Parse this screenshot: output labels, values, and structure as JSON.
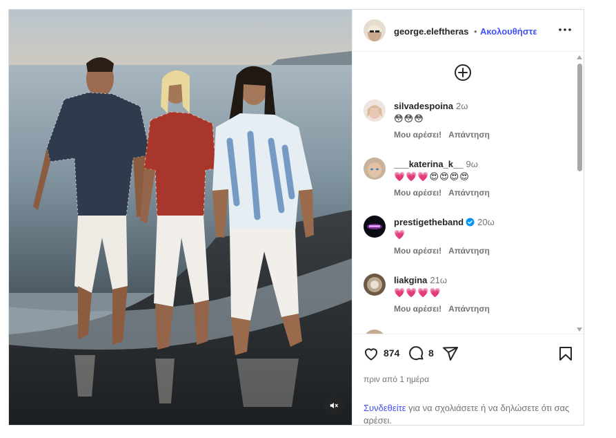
{
  "header": {
    "username": "george.eleftheras",
    "dot": "•",
    "follow_label": "Ακολουθήστε"
  },
  "comments": [
    {
      "username": "silvadespoina",
      "time": "2ω",
      "text": "😳😳😳",
      "like_label": "Μου αρέσει!",
      "reply_label": "Απάντηση"
    },
    {
      "username": "___katerina_k__",
      "time": "9ω",
      "text": "💗💗💗😍😍😍😍",
      "like_label": "Μου αρέσει!",
      "reply_label": "Απάντηση"
    },
    {
      "username": "prestigetheband",
      "time": "20ω",
      "text": "💗",
      "like_label": "Μου αρέσει!",
      "reply_label": "Απάντηση",
      "verified": true
    },
    {
      "username": "liakgina",
      "time": "21ω",
      "text": "💗💗💗💗",
      "like_label": "Μου αρέσει!",
      "reply_label": "Απάντηση"
    }
  ],
  "stats": {
    "likes": "874",
    "comments": "8",
    "posted": "πριν από 1 ημέρα"
  },
  "login_prompt": {
    "link": "Συνδεθείτε",
    "text": " για να σχολιάσετε ή να δηλώσετε ότι σας αρέσει."
  },
  "colors": {
    "accent": "#4150f7",
    "verified": "#0095f6",
    "secondary_text": "#737373"
  },
  "icons": [
    "volume-mute-icon",
    "more-options-icon",
    "add-comment-icon",
    "verified-icon",
    "heart-icon",
    "comment-icon",
    "share-icon",
    "bookmark-icon"
  ]
}
